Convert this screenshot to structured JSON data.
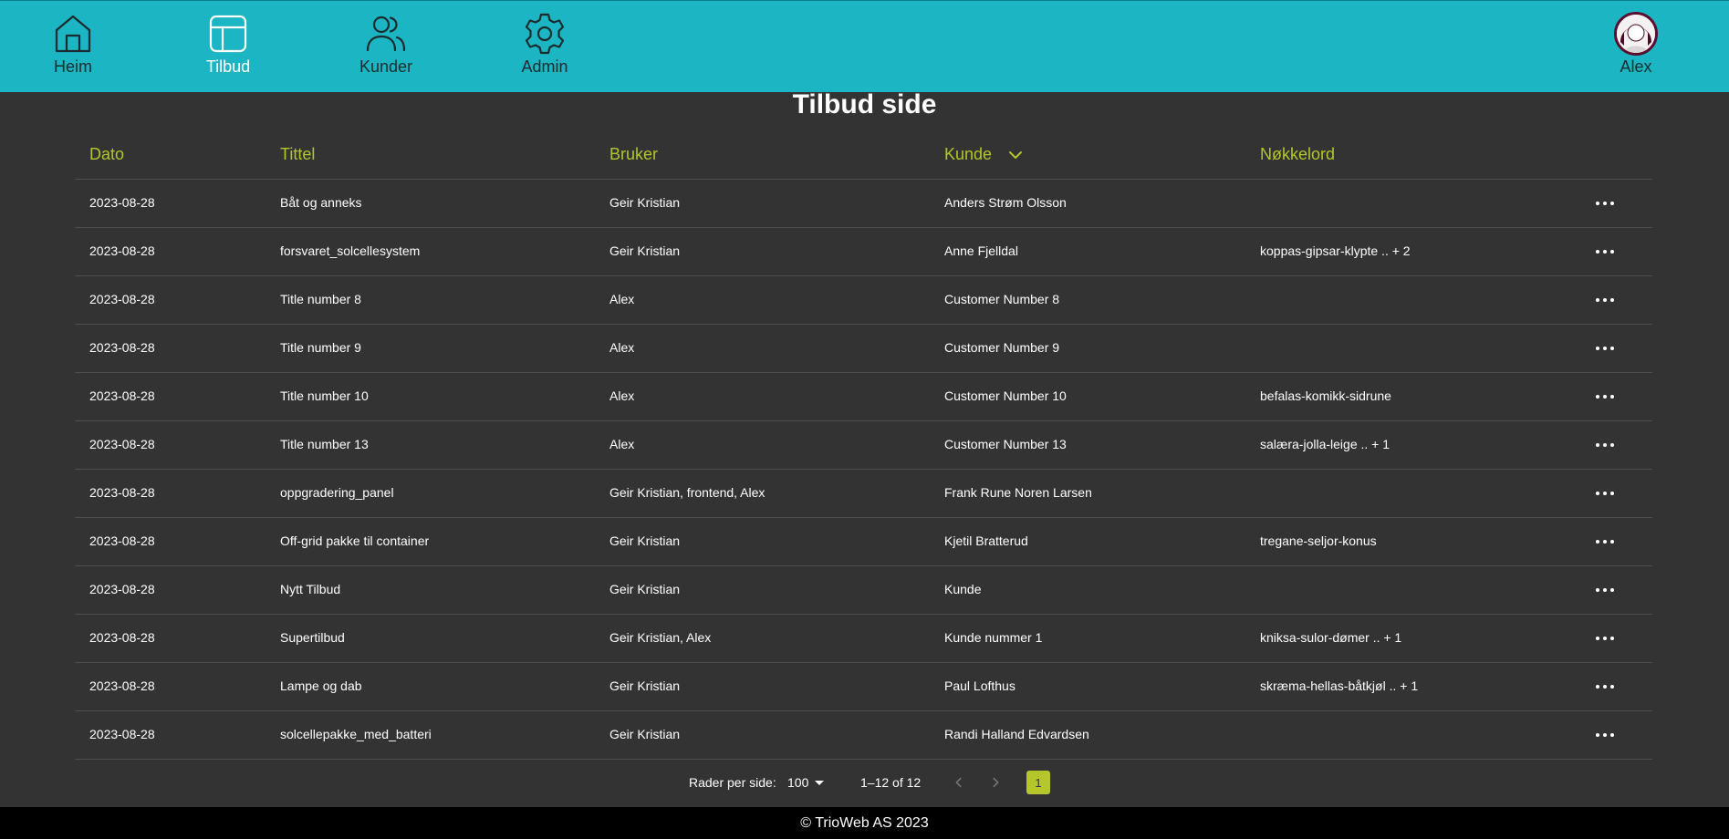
{
  "nav": {
    "items": [
      {
        "label": "Heim",
        "icon": "home-icon"
      },
      {
        "label": "Tilbud",
        "icon": "table-icon",
        "active": true
      },
      {
        "label": "Kunder",
        "icon": "users-icon"
      },
      {
        "label": "Admin",
        "icon": "gear-icon"
      }
    ],
    "user_label": "Alex"
  },
  "page": {
    "title": "Tilbud side"
  },
  "table": {
    "headers": {
      "dato": "Dato",
      "tittel": "Tittel",
      "bruker": "Bruker",
      "kunde": "Kunde",
      "nokkelord": "Nøkkelord"
    },
    "rows": [
      {
        "dato": "2023-08-28",
        "tittel": "Båt og anneks",
        "bruker": "Geir Kristian",
        "kunde": "Anders Strøm Olsson",
        "nokkelord": ""
      },
      {
        "dato": "2023-08-28",
        "tittel": "forsvaret_solcellesystem",
        "bruker": "Geir Kristian",
        "kunde": "Anne Fjelldal",
        "nokkelord": "koppas-gipsar-klypte .. + 2"
      },
      {
        "dato": "2023-08-28",
        "tittel": "Title number 8",
        "bruker": "Alex",
        "kunde": "Customer Number 8",
        "nokkelord": ""
      },
      {
        "dato": "2023-08-28",
        "tittel": "Title number 9",
        "bruker": "Alex",
        "kunde": "Customer Number 9",
        "nokkelord": ""
      },
      {
        "dato": "2023-08-28",
        "tittel": "Title number 10",
        "bruker": "Alex",
        "kunde": "Customer Number 10",
        "nokkelord": "befalas-komikk-sidrune"
      },
      {
        "dato": "2023-08-28",
        "tittel": "Title number 13",
        "bruker": "Alex",
        "kunde": "Customer Number 13",
        "nokkelord": "salæra-jolla-leige .. + 1"
      },
      {
        "dato": "2023-08-28",
        "tittel": "oppgradering_panel",
        "bruker": "Geir Kristian, frontend, Alex",
        "kunde": "Frank Rune Noren Larsen",
        "nokkelord": ""
      },
      {
        "dato": "2023-08-28",
        "tittel": "Off-grid pakke til container",
        "bruker": "Geir Kristian",
        "kunde": "Kjetil Bratterud",
        "nokkelord": "tregane-seljor-konus"
      },
      {
        "dato": "2023-08-28",
        "tittel": "Nytt Tilbud",
        "bruker": "Geir Kristian",
        "kunde": "Kunde",
        "nokkelord": ""
      },
      {
        "dato": "2023-08-28",
        "tittel": "Supertilbud",
        "bruker": "Geir Kristian, Alex",
        "kunde": "Kunde nummer 1",
        "nokkelord": "kniksa-sulor-dømer .. + 1"
      },
      {
        "dato": "2023-08-28",
        "tittel": "Lampe og dab",
        "bruker": "Geir Kristian",
        "kunde": "Paul Lofthus",
        "nokkelord": "skræma-hellas-båtkjøl .. + 1"
      },
      {
        "dato": "2023-08-28",
        "tittel": "solcellepakke_med_batteri",
        "bruker": "Geir Kristian",
        "kunde": "Randi Halland Edvardsen",
        "nokkelord": ""
      }
    ]
  },
  "pagination": {
    "rows_per_page_label": "Rader per side:",
    "rows_per_page_value": "100",
    "range": "1–12 of 12",
    "current_page": "1"
  },
  "footer": {
    "text": "© TrioWeb AS 2023"
  },
  "colors": {
    "topbar": "#1bb5c3",
    "background": "#333333",
    "accent": "#b5c62a",
    "footer": "#000000"
  }
}
